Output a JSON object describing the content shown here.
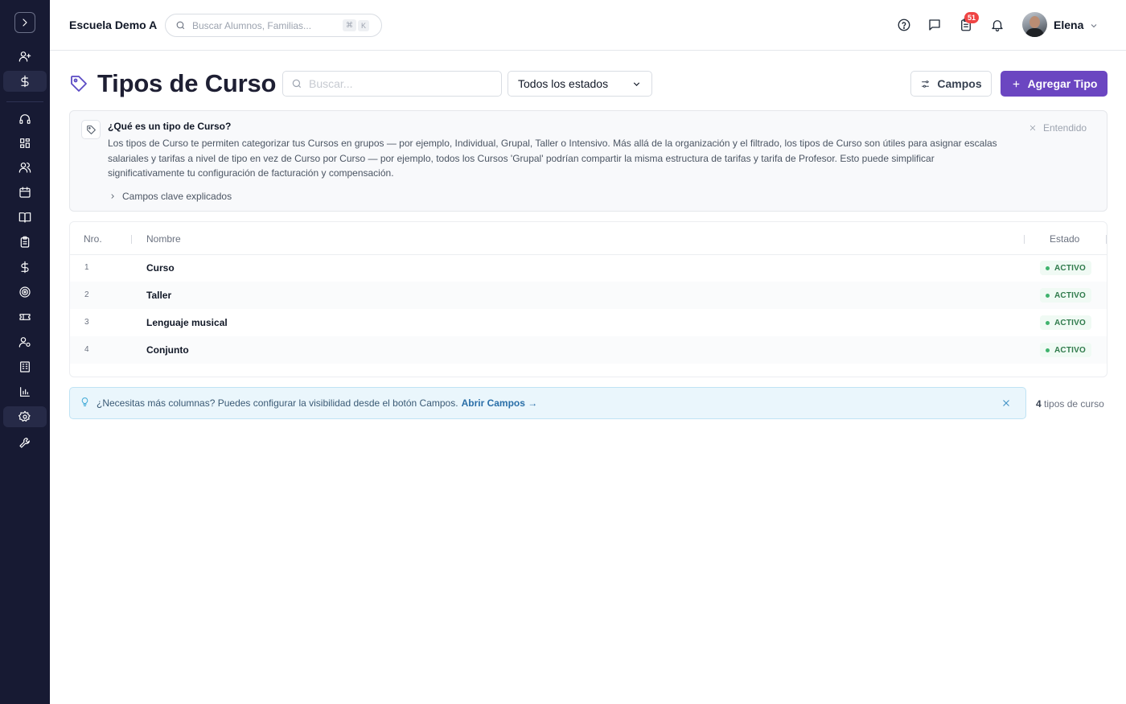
{
  "header": {
    "school_name": "Escuela Demo A",
    "search_placeholder": "Buscar Alumnos, Familias...",
    "shortcut_key1": "⌘",
    "shortcut_key2": "K",
    "notifications_count": "51",
    "user_name": "Elena"
  },
  "sidebar": {
    "items": [
      {
        "icon": "user-plus-icon"
      },
      {
        "icon": "dollar-icon"
      },
      {
        "icon": "headset-icon"
      },
      {
        "icon": "dashboard-icon"
      },
      {
        "icon": "users-icon"
      },
      {
        "icon": "calendar-icon"
      },
      {
        "icon": "book-icon"
      },
      {
        "icon": "clipboard-icon"
      },
      {
        "icon": "dollar-icon"
      },
      {
        "icon": "target-icon"
      },
      {
        "icon": "ticket-icon"
      },
      {
        "icon": "user-gear-icon"
      },
      {
        "icon": "building-icon"
      },
      {
        "icon": "chart-icon"
      },
      {
        "icon": "settings-icon"
      },
      {
        "icon": "wrench-icon"
      }
    ],
    "active_item": "settings-icon"
  },
  "page": {
    "title": "Tipos de Curso",
    "search_placeholder": "Buscar...",
    "status_filter": "Todos los estados",
    "campos_button": "Campos",
    "add_button": "Agregar Tipo"
  },
  "info": {
    "title": "¿Qué es un tipo de Curso?",
    "text": "Los tipos de Curso te permiten categorizar tus Cursos en grupos — por ejemplo, Individual, Grupal, Taller o Intensivo. Más allá de la organización y el filtrado, los tipos de Curso son útiles para asignar escalas salariales y tarifas a nivel de tipo en vez de Curso por Curso — por ejemplo, todos los Cursos 'Grupal' podrían compartir la misma estructura de tarifas y tarifa de Profesor. Esto puede simplificar significativamente tu configuración de facturación y compensación.",
    "dismiss": "Entendido",
    "expander": "Campos clave explicados"
  },
  "table": {
    "headers": {
      "num": "Nro.",
      "name": "Nombre",
      "status": "Estado"
    },
    "rows": [
      {
        "num": "1",
        "name": "Curso",
        "status": "ACTIVO"
      },
      {
        "num": "2",
        "name": "Taller",
        "status": "ACTIVO"
      },
      {
        "num": "3",
        "name": "Lenguaje musical",
        "status": "ACTIVO"
      },
      {
        "num": "4",
        "name": "Conjunto",
        "status": "ACTIVO"
      }
    ]
  },
  "tip": {
    "text": "¿Necesitas más columnas? Puedes configurar la visibilidad desde el botón Campos.",
    "link": "Abrir Campos →"
  },
  "footer": {
    "count": "4",
    "count_label": "tipos de curso"
  },
  "colors": {
    "sidebar_bg": "#171a33",
    "accent": "#6b46c1",
    "status_active": "#2f7a4b"
  }
}
